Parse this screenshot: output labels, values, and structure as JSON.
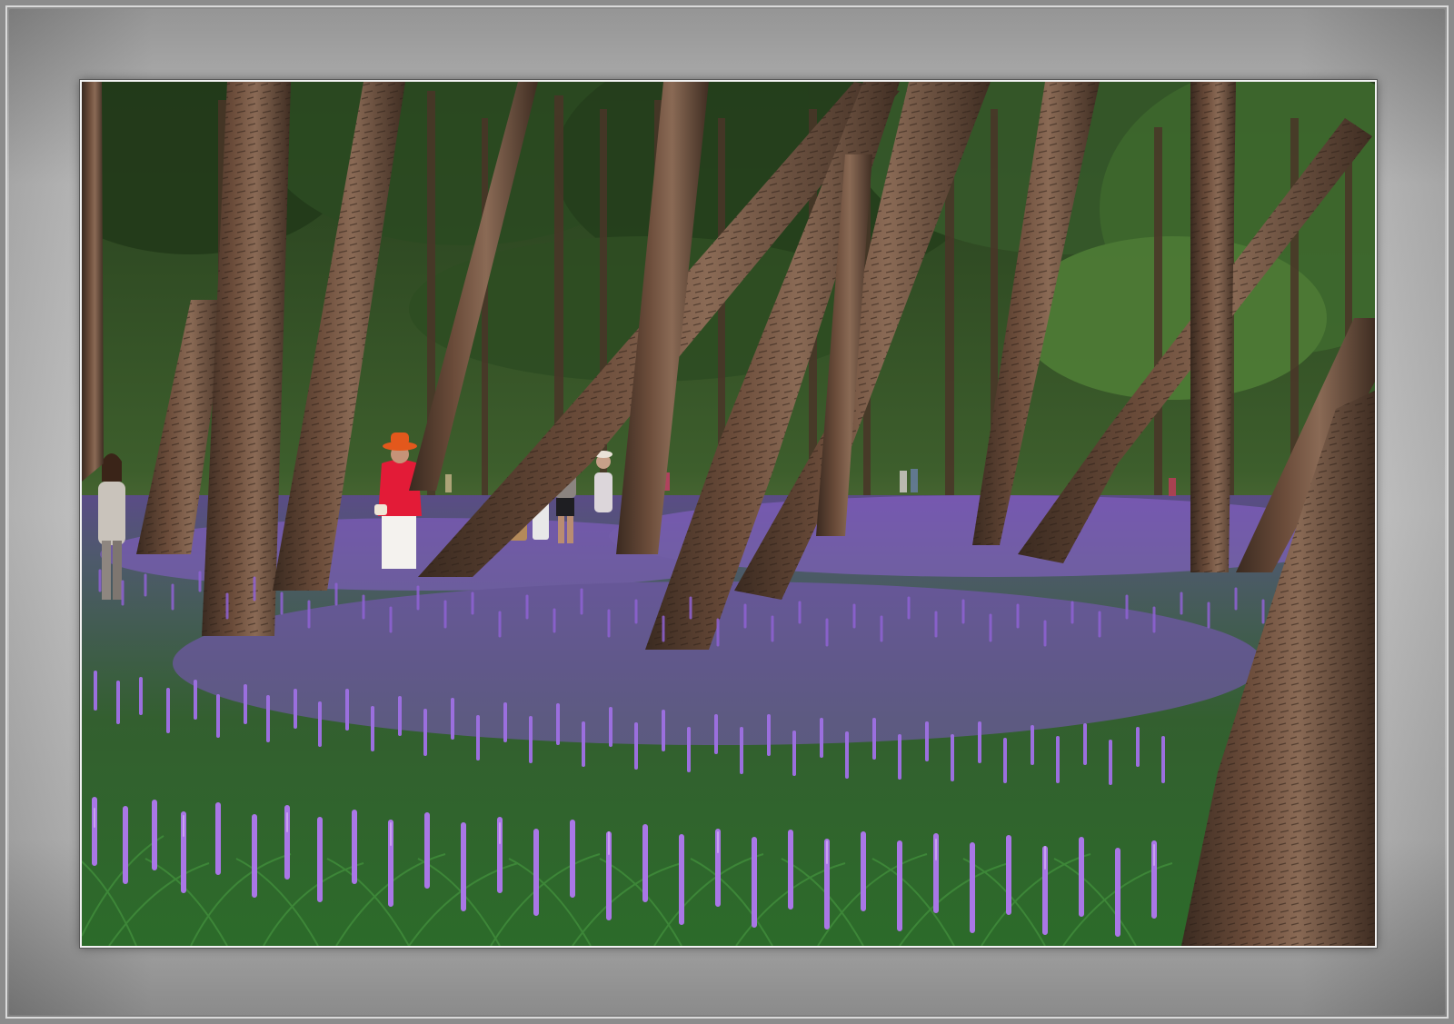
{
  "scene": {
    "canopy_color": "#2f4a24",
    "canopy_light": "#4f7a34",
    "bark_color": "#5a3f30",
    "bark_dark": "#3b2a20",
    "grass_color": "#2f6a2c",
    "flower_color": "#9a6bd6",
    "flower_light": "#c79af0",
    "frame_color": "#b8b8b8"
  }
}
